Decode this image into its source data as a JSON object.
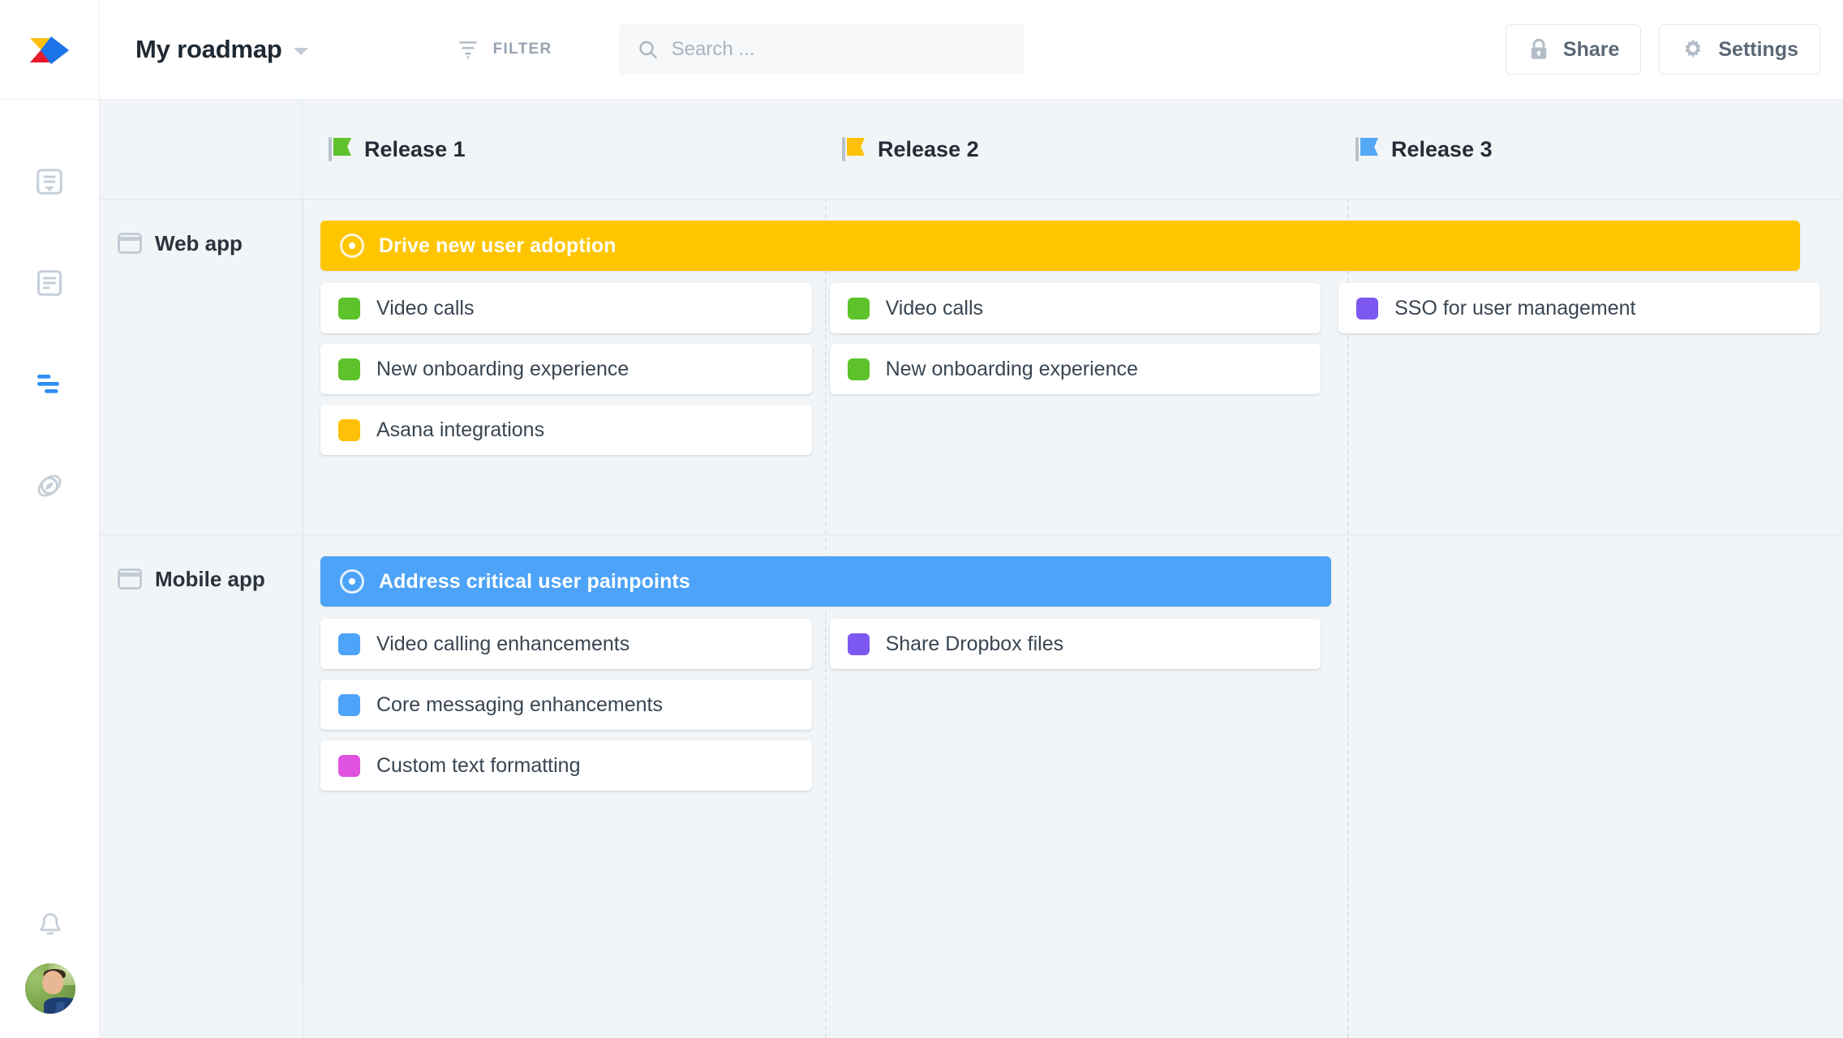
{
  "app": {
    "logo_icon": "aha-chevron-logo"
  },
  "topbar": {
    "doc_title": "My roadmap",
    "dropdown_icon": "chevron-down-icon",
    "filter": {
      "label": "FILTER",
      "icon": "filter-funnel-icon"
    },
    "search": {
      "placeholder": "Search ...",
      "value": "",
      "icon": "search-icon"
    },
    "share": {
      "label": "Share",
      "icon": "lock-icon"
    },
    "settings": {
      "label": "Settings",
      "icon": "gear-icon"
    }
  },
  "rail": {
    "items": [
      {
        "icon": "notebook-document-icon",
        "active": false
      },
      {
        "icon": "document-lines-icon",
        "active": false
      },
      {
        "icon": "roadmap-bars-icon",
        "active": true
      },
      {
        "icon": "compass-rocket-icon",
        "active": false
      }
    ],
    "bell_icon": "bell-icon",
    "avatar_icon": "user-avatar"
  },
  "board": {
    "columns": [
      {
        "name": "Release 1",
        "flag_color": "#5ec22a",
        "icon": "flag-icon"
      },
      {
        "name": "Release 2",
        "flag_color": "#ffc107",
        "icon": "flag-icon"
      },
      {
        "name": "Release 3",
        "flag_color": "#53a7f5",
        "icon": "flag-icon"
      }
    ],
    "rows": [
      {
        "name": "Web app",
        "icon": "window-icon",
        "epic": {
          "label": "Drive new user adoption",
          "color": "#ffc600",
          "icon": "target-icon",
          "span_start": 0,
          "span_end": 2
        },
        "cells": [
          [
            {
              "label": "Video calls",
              "color": "#5ec22a"
            },
            {
              "label": "New onboarding experience",
              "color": "#5ec22a"
            },
            {
              "label": "Asana integrations",
              "color": "#ffc107"
            }
          ],
          [
            {
              "label": "Video calls",
              "color": "#5ec22a"
            },
            {
              "label": "New onboarding experience",
              "color": "#5ec22a"
            }
          ],
          [
            {
              "label": "SSO for user management",
              "color": "#7c58f0"
            }
          ]
        ]
      },
      {
        "name": "Mobile app",
        "icon": "window-icon",
        "epic": {
          "label": "Address critical user painpoints",
          "color": "#4da3f7",
          "icon": "target-icon",
          "span_start": 0,
          "span_end": 1
        },
        "cells": [
          [
            {
              "label": "Video calling enhancements",
              "color": "#4da3f7"
            },
            {
              "label": "Core messaging enhancements",
              "color": "#4da3f7"
            },
            {
              "label": "Custom text formatting",
              "color": "#e052e0"
            }
          ],
          [
            {
              "label": "Share Dropbox files",
              "color": "#7c58f0"
            }
          ],
          []
        ]
      }
    ]
  },
  "colors": {
    "accent_blue": "#4da3f7",
    "epic_yellow": "#ffc600",
    "board_bg": "#f2f5f7",
    "card_bg": "#ffffff"
  }
}
